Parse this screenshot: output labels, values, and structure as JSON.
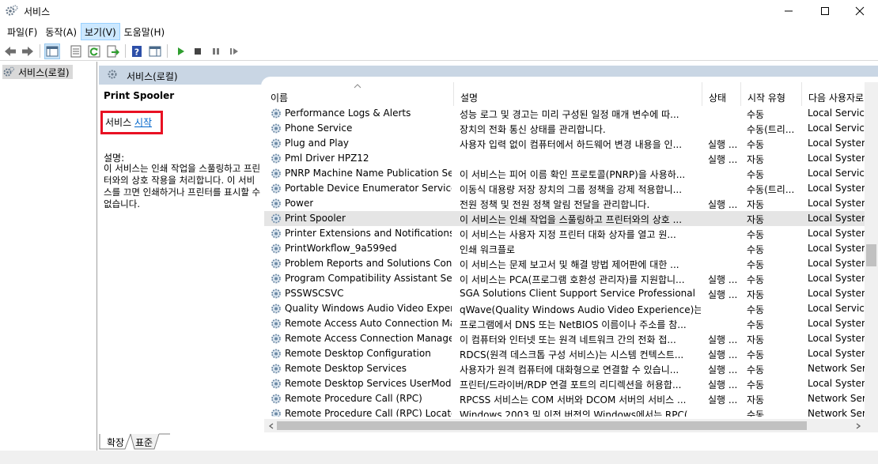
{
  "titlebar": {
    "title": "서비스"
  },
  "menu": [
    "파일(F)",
    "동작(A)",
    "보기(V)",
    "도움말(H)"
  ],
  "tree": {
    "root_label": "서비스(로컬)"
  },
  "pane": {
    "header_title": "서비스(로컬)"
  },
  "description": {
    "service_name": "Print Spooler",
    "start_prefix": "서비스 ",
    "start_link": "시작",
    "label": "설명:",
    "body": "이 서비스는 인쇄 작업을 스풀링하고 프린터와의 상호 작용을 처리합니다. 이 서비스를 끄면 인쇄하거나 프린터를 표시할 수 없습니다."
  },
  "columns": {
    "name": "이름",
    "description": "설명",
    "status": "상태",
    "startup": "시작 유형",
    "logon": "다음 사용자로"
  },
  "rows": [
    {
      "name": "Performance Logs & Alerts",
      "desc": "성능 로그 및 경고는 미리 구성된 일정 매개 변수에 따...",
      "status": "",
      "startup": "수동",
      "logon": "Local Service"
    },
    {
      "name": "Phone Service",
      "desc": "장치의 전화 통신 상태를 관리합니다.",
      "status": "",
      "startup": "수동(트리...",
      "logon": "Local Service"
    },
    {
      "name": "Plug and Play",
      "desc": "사용자 입력 없이 컴퓨터에서 하드웨어 변경 내용을 인...",
      "status": "실행 ...",
      "startup": "수동",
      "logon": "Local System"
    },
    {
      "name": "Pml Driver HPZ12",
      "desc": "",
      "status": "실행 ...",
      "startup": "자동",
      "logon": "Local System"
    },
    {
      "name": "PNRP Machine Name Publication Ser...",
      "desc": "이 서비스는 피어 이름 확인 프로토콜(PNRP)을 사용하...",
      "status": "",
      "startup": "수동",
      "logon": "Local Service"
    },
    {
      "name": "Portable Device Enumerator Service",
      "desc": "이동식 대용량 저장 장치의 그룹 정책을 강제 적용합니...",
      "status": "",
      "startup": "수동(트리...",
      "logon": "Local System"
    },
    {
      "name": "Power",
      "desc": "전원 정책 및 전원 정책 알림 전달을 관리합니다.",
      "status": "실행 ...",
      "startup": "자동",
      "logon": "Local System"
    },
    {
      "name": "Print Spooler",
      "desc": "이 서비스는 인쇄 작업을 스풀링하고 프린터와의 상호 ...",
      "status": "",
      "startup": "자동",
      "logon": "Local System",
      "selected": true
    },
    {
      "name": "Printer Extensions and Notifications",
      "desc": "이 서비스는 사용자 지정 프린터 대화 상자를 열고 원...",
      "status": "",
      "startup": "수동",
      "logon": "Local System"
    },
    {
      "name": "PrintWorkflow_9a599ed",
      "desc": "인쇄 워크플로",
      "status": "",
      "startup": "수동",
      "logon": "Local System"
    },
    {
      "name": "Problem Reports and Solutions Contr...",
      "desc": "이 서비스는 문제 보고서 및 해결 방법 제어판에 대한 ...",
      "status": "",
      "startup": "수동",
      "logon": "Local System"
    },
    {
      "name": "Program Compatibility Assistant Servi...",
      "desc": "이 서비스는 PCA(프로그램 호환성 관리자)를 지원합니...",
      "status": "실행 ...",
      "startup": "수동",
      "logon": "Local System"
    },
    {
      "name": "PSSWSCSVC",
      "desc": "SGA Solutions Client Support Service Professional",
      "status": "실행 ...",
      "startup": "자동",
      "logon": "Local System"
    },
    {
      "name": "Quality Windows Audio Video Experie...",
      "desc": "qWave(Quality Windows Audio Video Experience)는 I...",
      "status": "",
      "startup": "수동",
      "logon": "Local Service"
    },
    {
      "name": "Remote Access Auto Connection Ma...",
      "desc": "프로그램에서 DNS 또는 NetBIOS 이름이나 주소를 참...",
      "status": "",
      "startup": "수동",
      "logon": "Local System"
    },
    {
      "name": "Remote Access Connection Manager",
      "desc": "이 컴퓨터와 인터넷 또는 원격 네트워크 간의 전화 접...",
      "status": "실행 ...",
      "startup": "자동",
      "logon": "Local System"
    },
    {
      "name": "Remote Desktop Configuration",
      "desc": "RDCS(원격 데스크톱 구성 서비스)는 시스템 컨텍스트...",
      "status": "실행 ...",
      "startup": "수동",
      "logon": "Local System"
    },
    {
      "name": "Remote Desktop Services",
      "desc": "사용자가 원격 컴퓨터에 대화형으로 연결할 수 있습니...",
      "status": "실행 ...",
      "startup": "수동",
      "logon": "Network Serv"
    },
    {
      "name": "Remote Desktop Services UserMode ...",
      "desc": "프린터/드라이버/RDP 연결 포트의 리디렉션을 허용합...",
      "status": "실행 ...",
      "startup": "수동",
      "logon": "Local System"
    },
    {
      "name": "Remote Procedure Call (RPC)",
      "desc": "RPCSS 서비스는 COM 서버와 DCOM 서버의 서비스 ...",
      "status": "실행 ...",
      "startup": "자동",
      "logon": "Network Serv"
    },
    {
      "name": "Remote Procedure Call (RPC) Locator",
      "desc": "Windows 2003 및 이전 버전의 Windows에서는 RPC(...",
      "status": "",
      "startup": "수동",
      "logon": "Network Serv"
    }
  ],
  "tabs": [
    "확장",
    "표준"
  ]
}
